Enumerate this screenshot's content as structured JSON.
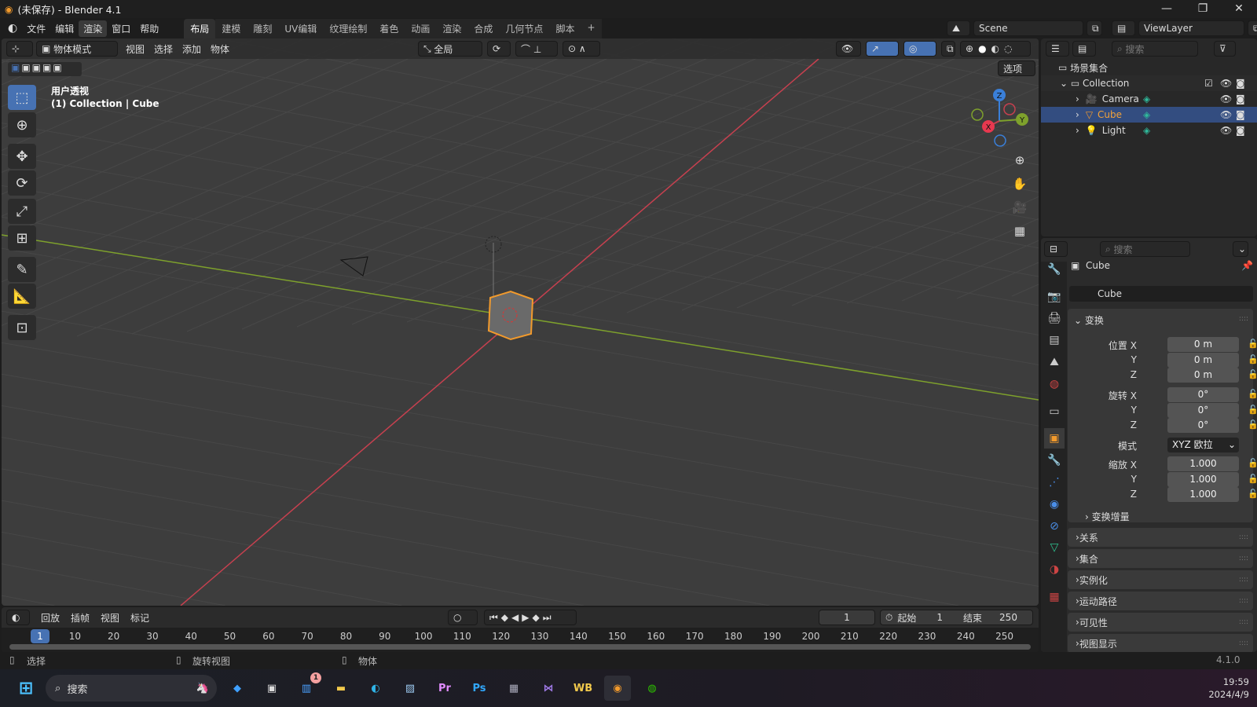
{
  "window": {
    "title": "(未保存) - Blender 4.1",
    "minimize": "—",
    "maximize": "❐",
    "close": "✕"
  },
  "menu": [
    "文件",
    "编辑",
    "渲染",
    "窗口",
    "帮助"
  ],
  "menu_active": "渲染",
  "workspaces": [
    "布局",
    "建模",
    "雕刻",
    "UV编辑",
    "纹理绘制",
    "着色",
    "动画",
    "渲染",
    "合成",
    "几何节点",
    "脚本",
    "+"
  ],
  "workspace_active": "布局",
  "scene": {
    "name": "Scene",
    "view_layer": "ViewLayer"
  },
  "viewport": {
    "mode": "物体模式",
    "menus": [
      "视图",
      "选择",
      "添加",
      "物体"
    ],
    "orientation": "全局",
    "options": "选项",
    "view_name": "用户透视",
    "context": "(1) Collection | Cube",
    "colors": {
      "x_axis": "#c6404f",
      "y_axis": "#7ea12c",
      "z_axis": "#3a7fd8",
      "selected": "#f29a2c",
      "active_tool": "#4772b3"
    },
    "gizmo": {
      "x": "X",
      "y": "Y",
      "z": "Z"
    }
  },
  "outliner": {
    "search_placeholder": "搜索",
    "scene_collection": "场景集合",
    "collection": "Collection",
    "items": [
      {
        "name": "Camera",
        "icon": "camera-icon"
      },
      {
        "name": "Cube",
        "icon": "mesh-icon",
        "selected": true
      },
      {
        "name": "Light",
        "icon": "light-icon"
      }
    ]
  },
  "properties": {
    "search_placeholder": "搜索",
    "object_name": "Cube",
    "datablock": "Cube",
    "transform_header": "变换",
    "location": {
      "label": "位置",
      "x": "0 m",
      "y": "0 m",
      "z": "0 m"
    },
    "rotation": {
      "label": "旋转",
      "x": "0°",
      "y": "0°",
      "z": "0°"
    },
    "mode_label": "模式",
    "mode_value": "XYZ 欧拉",
    "scale": {
      "label": "缩放",
      "x": "1.000",
      "y": "1.000",
      "z": "1.000"
    },
    "axis": {
      "x": "X",
      "y": "Y",
      "z": "Z"
    },
    "delta": "变换增量",
    "panels": [
      "关系",
      "集合",
      "实例化",
      "运动路径",
      "可见性",
      "视图显示"
    ]
  },
  "timeline": {
    "menus": [
      "回放",
      "插帧",
      "视图",
      "标记"
    ],
    "current_frame": "1",
    "start_label": "起始",
    "start": "1",
    "end_label": "结束",
    "end": "250",
    "ticks": [
      "10",
      "20",
      "30",
      "40",
      "50",
      "60",
      "70",
      "80",
      "90",
      "100",
      "110",
      "120",
      "130",
      "140",
      "150",
      "160",
      "170",
      "180",
      "190",
      "200",
      "210",
      "220",
      "230",
      "240",
      "250"
    ]
  },
  "status": {
    "select": "选择",
    "rotate": "旋转视图",
    "object": "物体",
    "version": "4.1.0"
  },
  "taskbar": {
    "search": "搜索",
    "time": "19:59",
    "date": "2024/4/9",
    "badge": "1",
    "apps": [
      "copilot",
      "task-view",
      "store",
      "file-explorer",
      "edge",
      "monitor",
      "premiere",
      "photoshop",
      "calculator",
      "visual-studio",
      "workbench",
      "blender",
      "wechat"
    ]
  }
}
